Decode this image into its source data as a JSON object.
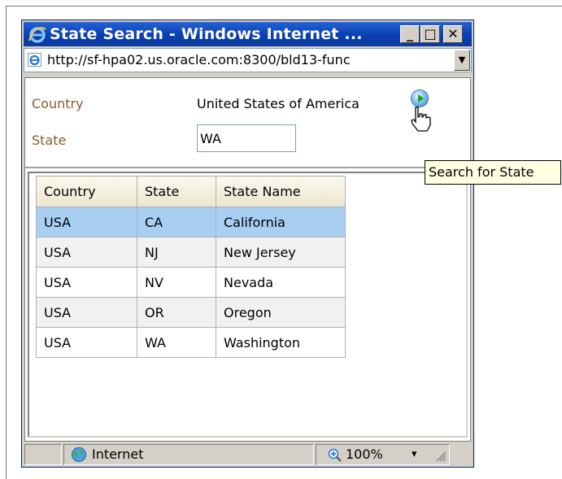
{
  "window": {
    "title": "State Search - Windows Internet ...",
    "minimize_glyph": "_",
    "maximize_glyph": "□",
    "close_glyph": "✕"
  },
  "address_bar": {
    "url": "http://sf-hpa02.us.oracle.com:8300/bld13-func",
    "dropdown_glyph": "▼"
  },
  "form": {
    "country_label": "Country",
    "country_value": "United States of America",
    "state_label": "State",
    "state_value": "WA",
    "search_tooltip": "Search for State"
  },
  "grid": {
    "columns": [
      "Country",
      "State",
      "State Name"
    ],
    "rows": [
      [
        "USA",
        "CA",
        "California"
      ],
      [
        "USA",
        "NJ",
        "New Jersey"
      ],
      [
        "USA",
        "NV",
        "Nevada"
      ],
      [
        "USA",
        "OR",
        "Oregon"
      ],
      [
        "USA",
        "WA",
        "Washington"
      ]
    ],
    "selected_row": 0
  },
  "status_bar": {
    "zone": "Internet",
    "zoom": "100%",
    "zoom_dropdown_glyph": "▾"
  },
  "icons": {
    "app": "ie-logo-icon",
    "page": "ie-page-icon",
    "zone": "globe-icon",
    "zoom": "zoom-icon",
    "search": "search-go-icon",
    "cursor": "hand-cursor-icon",
    "resize": "resize-grip-icon"
  },
  "colors": {
    "title_bar": "#0a3fb0",
    "label_text": "#8b5a2b",
    "selected_row": "#a8cff2",
    "tooltip_bg": "#ffffe1"
  }
}
